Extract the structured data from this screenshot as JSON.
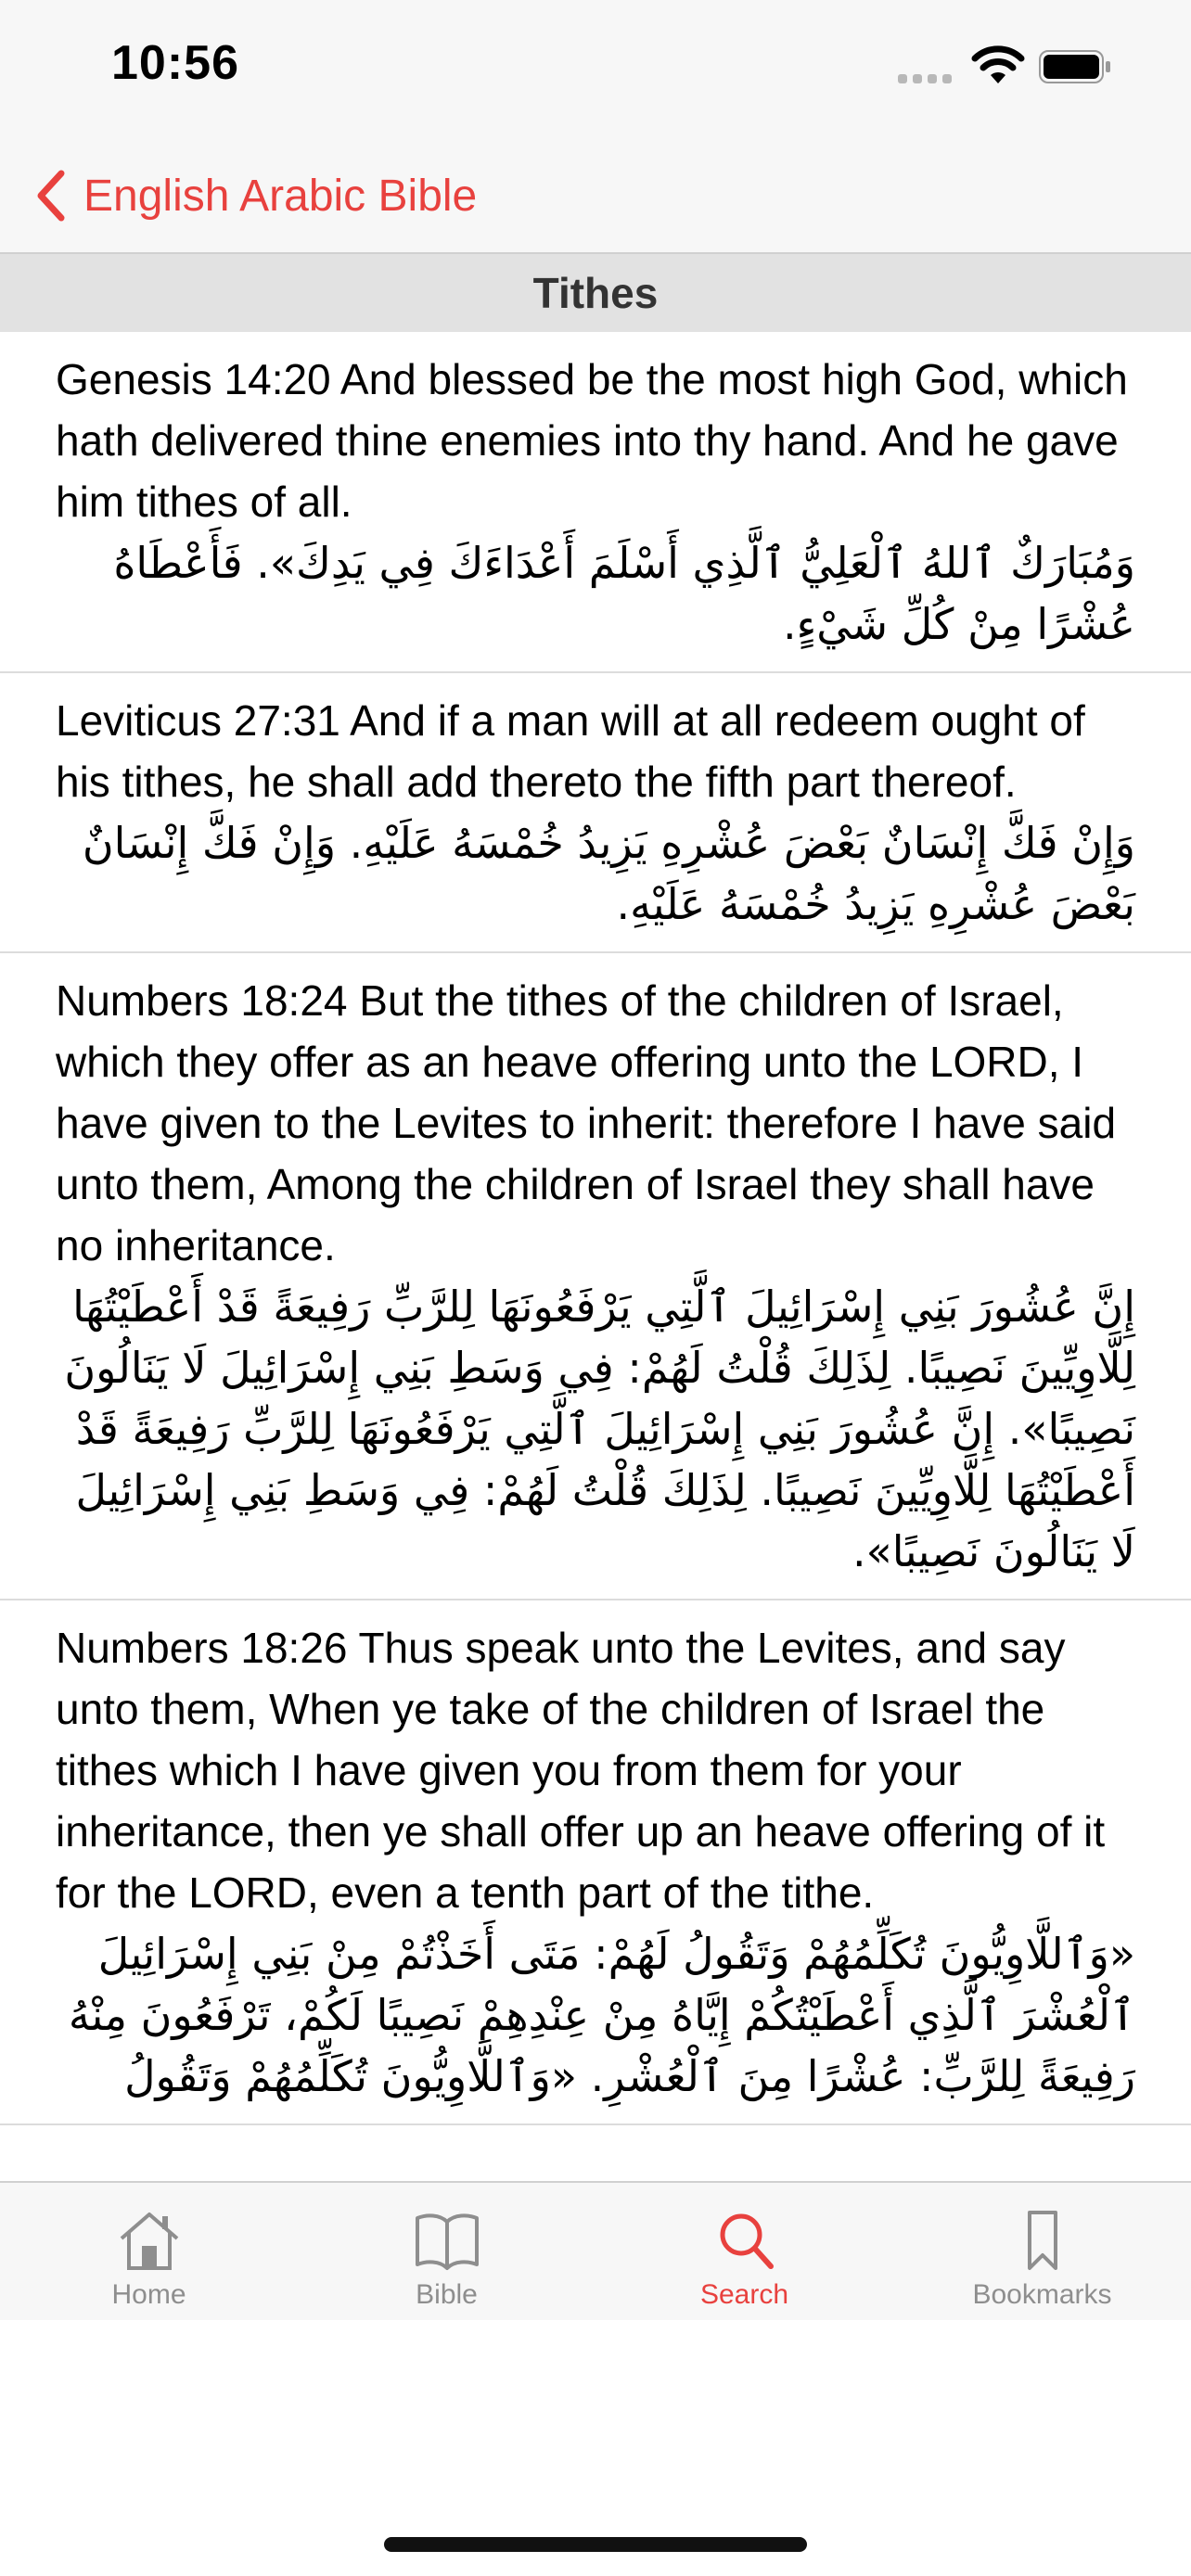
{
  "status_bar": {
    "time": "10:56"
  },
  "nav": {
    "back_label": "English Arabic Bible"
  },
  "section": {
    "title": "Tithes"
  },
  "verses": [
    {
      "english": "Genesis 14:20 And blessed be the most high God, which hath delivered thine enemies into thy hand. And he gave him tithes of all.",
      "arabic": "وَمُبَارَكٌ ٱللهُ ٱلْعَلِيُّ ٱلَّذِي أَسْلَمَ أَعْدَاءَكَ فِي يَدِكَ». فَأَعْطَاهُ عُشْرًا مِنْ كُلِّ شَيْءٍ."
    },
    {
      "english": "Leviticus 27:31 And if a man will at all redeem ought of his tithes, he shall add thereto the fifth part thereof.",
      "arabic": "وَإِنْ فَكَّ إِنْسَانٌ بَعْضَ عُشْرِهِ يَزِيدُ خُمْسَهُ عَلَيْهِ. وَإِنْ فَكَّ إِنْسَانٌ بَعْضَ عُشْرِهِ يَزِيدُ خُمْسَهُ عَلَيْهِ."
    },
    {
      "english": "Numbers 18:24 But the tithes of the children of Israel, which they offer as an heave offering unto the LORD, I have given to the Levites to inherit: therefore I have said unto them, Among the children of Israel they shall have no inheritance.",
      "arabic": "إِنَّ عُشُورَ بَنِي إِسْرَائِيلَ ٱلَّتِي يَرْفَعُونَهَا لِلرَّبِّ رَفِيعَةً قَدْ أَعْطَيْتُهَا لِلَّاوِيِّينَ نَصِيبًا. لِذَلِكَ قُلْتُ لَهُمْ: فِي وَسَطِ بَنِي إِسْرَائِيلَ لَا يَنَالُونَ نَصِيبًا». إِنَّ عُشُورَ بَنِي إِسْرَائِيلَ ٱلَّتِي يَرْفَعُونَهَا لِلرَّبِّ رَفِيعَةً قَدْ أَعْطَيْتُهَا لِلَّاوِيِّينَ نَصِيبًا. لِذَلِكَ قُلْتُ لَهُمْ: فِي وَسَطِ بَنِي إِسْرَائِيلَ لَا يَنَالُونَ نَصِيبًا»."
    },
    {
      "english": "Numbers 18:26 Thus speak unto the Levites, and say unto them, When ye take of the children of Israel the tithes which I have given you from them for your inheritance, then ye shall offer up an heave offering of it for the LORD, even a tenth part of the tithe.",
      "arabic": "«وَٱللَّاوِيُّونَ تُكَلِّمُهُمْ وَتَقُولُ لَهُمْ: مَتَى أَخَذْتُمْ مِنْ بَنِي إِسْرَائِيلَ ٱلْعُشْرَ ٱلَّذِي أَعْطَيْتُكُمْ إِيَّاهُ مِنْ عِنْدِهِمْ نَصِيبًا لَكُمْ، تَرْفَعُونَ مِنْهُ رَفِيعَةً لِلرَّبِّ: عُشْرًا مِنَ ٱلْعُشْرِ. «وَٱللَّاوِيُّونَ تُكَلِّمُهُمْ وَتَقُولُ"
    }
  ],
  "tabs": [
    {
      "label": "Home",
      "icon": "home-icon"
    },
    {
      "label": "Bible",
      "icon": "book-icon"
    },
    {
      "label": "Search",
      "icon": "search-icon",
      "active": true
    },
    {
      "label": "Bookmarks",
      "icon": "bookmark-icon"
    }
  ],
  "colors": {
    "accent": "#e8413e",
    "inactive": "#8e8e8e",
    "bar_bg": "#f7f7f7",
    "header_bg": "#e2e2e2"
  }
}
